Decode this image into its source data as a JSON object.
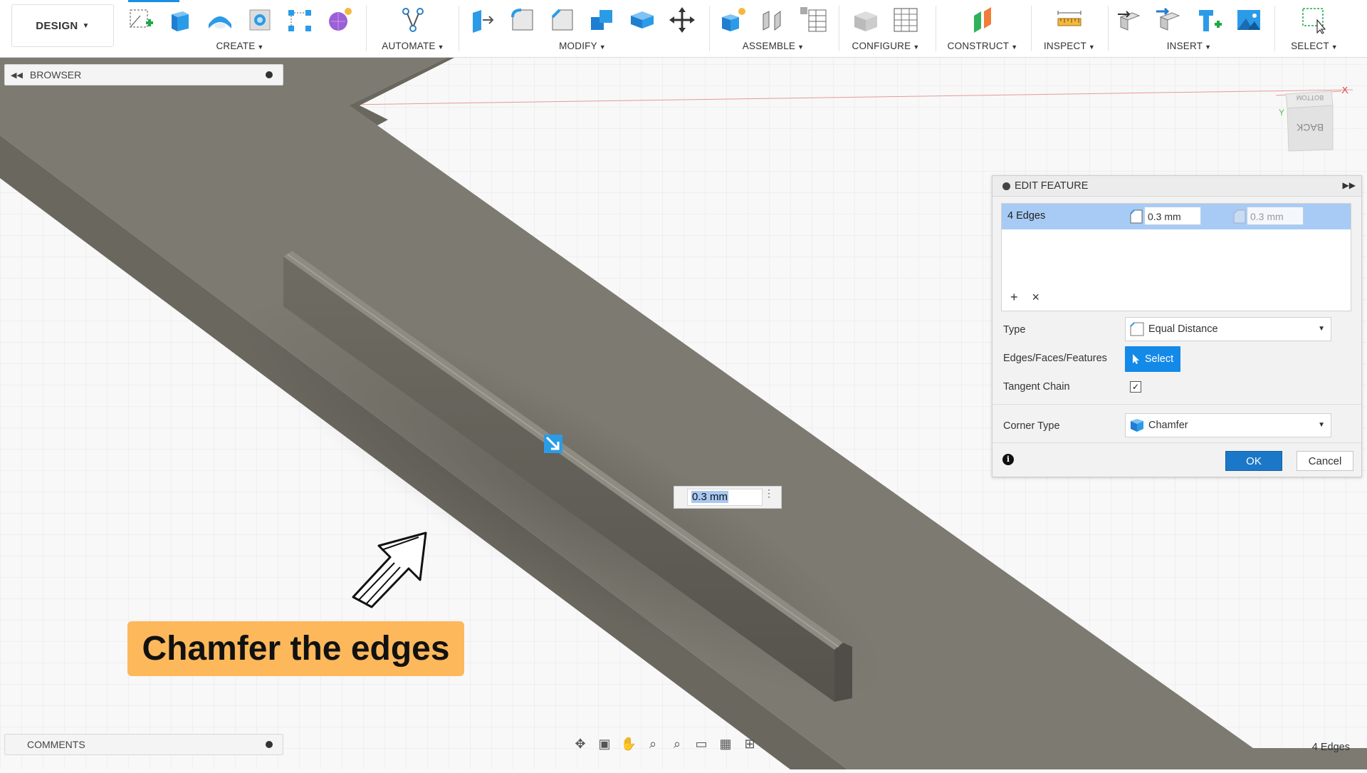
{
  "toolbar": {
    "workspace_label": "DESIGN",
    "groups": [
      {
        "label": "CREATE"
      },
      {
        "label": "AUTOMATE"
      },
      {
        "label": "MODIFY"
      },
      {
        "label": "ASSEMBLE"
      },
      {
        "label": "CONFIGURE"
      },
      {
        "label": "CONSTRUCT"
      },
      {
        "label": "INSPECT"
      },
      {
        "label": "INSERT"
      },
      {
        "label": "SELECT"
      }
    ]
  },
  "browser": {
    "title": "BROWSER"
  },
  "comments": {
    "title": "COMMENTS"
  },
  "viewcube": {
    "front": "BACK",
    "top": "BOTTOM",
    "axis_x": "X",
    "axis_y": "Y"
  },
  "dialog": {
    "title": "EDIT FEATURE",
    "selection": {
      "name": "4 Edges",
      "distance_1": "0.3 mm",
      "distance_2": "0.3 mm"
    },
    "type_label": "Type",
    "type_value": "Equal Distance",
    "edges_label": "Edges/Faces/Features",
    "select_button": "Select",
    "tangent_label": "Tangent Chain",
    "tangent_checked": true,
    "corner_label": "Corner Type",
    "corner_value": "Chamfer",
    "ok": "OK",
    "cancel": "Cancel"
  },
  "float_input": {
    "value": "0.3 mm"
  },
  "callout": {
    "text": "Chamfer the edges"
  },
  "status": {
    "text": "4 Edges"
  },
  "colors": {
    "accent": "#1389e8",
    "callout": "#fcb85b",
    "model": "#7d7a70",
    "selected_row": "#a7cbf4"
  }
}
